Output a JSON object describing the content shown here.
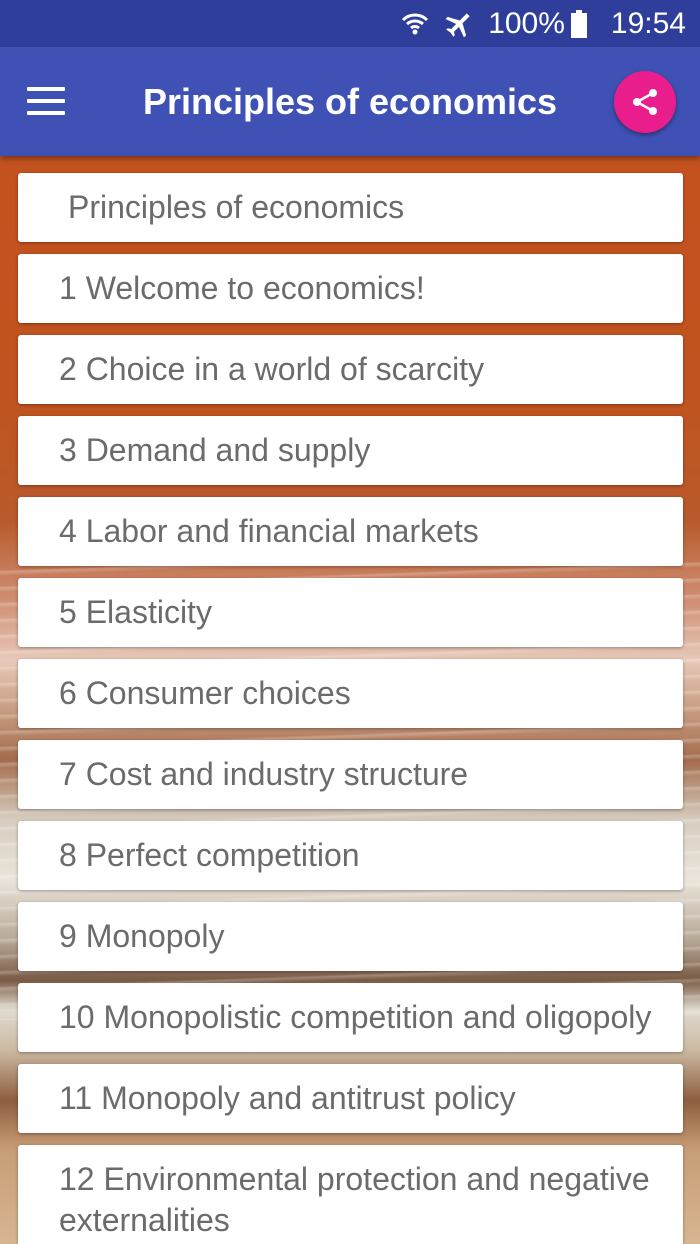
{
  "status_bar": {
    "icons": [
      "wifi-icon",
      "airplane-mode-icon",
      "battery-icon"
    ],
    "battery": "100%",
    "time": "19:54"
  },
  "app_bar": {
    "title": "Principles of economics",
    "menu_icon": "hamburger-menu-icon",
    "share_icon": "share-icon"
  },
  "colors": {
    "app_bar": "#3f51b5",
    "status_bar": "#2f3e9a",
    "accent": "#e91e8c",
    "card_text": "#6b6b6b"
  },
  "list": {
    "header": "Principles of economics",
    "items": [
      "1 Welcome to economics!",
      "2 Choice in a world of scarcity",
      "3 Demand and supply",
      "4 Labor and financial markets",
      "5 Elasticity",
      "6 Consumer choices",
      "7 Cost and industry structure",
      "8 Perfect competition",
      "9 Monopoly",
      "10 Monopolistic competition and oligopoly",
      "11 Monopoly and antitrust policy",
      "12 Environmental protection and negative externalities"
    ]
  }
}
